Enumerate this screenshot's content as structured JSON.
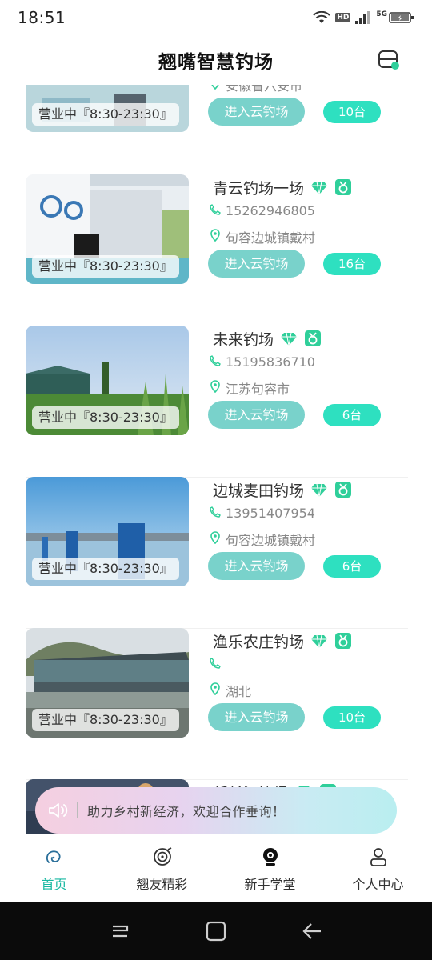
{
  "status_bar": {
    "time": "18:51",
    "hd": "HD",
    "network": "5G"
  },
  "header": {
    "title": "翘嘴智慧钓场",
    "scan_icon": "scan-icon"
  },
  "list": [
    {
      "name": "",
      "phone": "",
      "address": "安徽省六安市",
      "hours": "营业中『8:30-23:30』",
      "enter": "进入云钓场",
      "count": "10台"
    },
    {
      "name": "青云钓场一场",
      "phone": "15262946805",
      "address": "句容边城镇戴村",
      "hours": "营业中『8:30-23:30』",
      "enter": "进入云钓场",
      "count": "16台"
    },
    {
      "name": "未来钓场",
      "phone": "15195836710",
      "address": "江苏句容市",
      "hours": "营业中『8:30-23:30』",
      "enter": "进入云钓场",
      "count": "6台"
    },
    {
      "name": "边城麦田钓场",
      "phone": "13951407954",
      "address": "句容边城镇戴村",
      "hours": "营业中『8:30-23:30』",
      "enter": "进入云钓场",
      "count": "6台"
    },
    {
      "name": "渔乐农庄钓场",
      "phone": "",
      "address": "湖北",
      "hours": "营业中『8:30-23:30』",
      "enter": "进入云钓场",
      "count": "10台"
    },
    {
      "name": "新长江钓场",
      "phone": "",
      "address": "",
      "hours": "",
      "enter": "",
      "count": ""
    }
  ],
  "notice": {
    "text": "助力乡村新经济，欢迎合作垂询！",
    "icon": "speaker-icon"
  },
  "tabs": [
    {
      "label": "首页",
      "icon": "home-icon",
      "active": true
    },
    {
      "label": "翘友精彩",
      "icon": "moments-icon",
      "active": false
    },
    {
      "label": "新手学堂",
      "icon": "camera-icon",
      "active": false
    },
    {
      "label": "个人中心",
      "icon": "profile-icon",
      "active": false
    }
  ],
  "colors": {
    "accent": "#17b8a1",
    "enter_button": "#79d2cb",
    "count_badge": "#2ee0c0",
    "gem": "#2fcf9a"
  }
}
